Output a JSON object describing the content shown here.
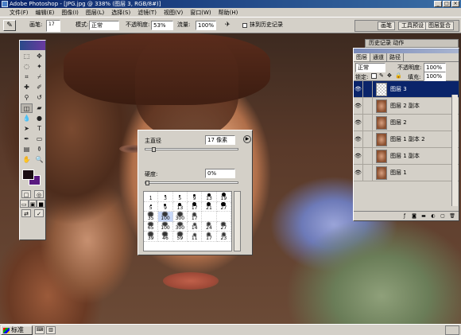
{
  "window": {
    "title": "Adobe Photoshop - [JPG.jpg @ 338% (图层 3, RGB/8#)]",
    "buttons": [
      "_",
      "□",
      "×"
    ]
  },
  "menu": [
    "文件(F)",
    "编辑(E)",
    "图像(I)",
    "图层(L)",
    "选择(S)",
    "滤镜(T)",
    "视图(V)",
    "窗口(W)",
    "帮助(H)"
  ],
  "options": {
    "brush_label": "画笔:",
    "brush_size": "17",
    "mode_label": "模式:",
    "mode_value": "正常",
    "opacity_label": "不透明度:",
    "opacity_value": "53%",
    "flow_label": "流量:",
    "flow_value": "100%",
    "history_checkbox_label": "抹到历史记录",
    "well_tabs": [
      "画笔",
      "工具预设",
      "图层复合"
    ]
  },
  "brush_popup": {
    "master_diameter_label": "主直径",
    "master_diameter_value": "17 像素",
    "master_diameter_fraction": 0.07,
    "hardness_label": "硬度:",
    "hardness_value": "0%",
    "hardness_fraction": 0.0,
    "presets": [
      {
        "size": 1,
        "label": "1"
      },
      {
        "size": 3,
        "label": "3"
      },
      {
        "size": 5,
        "label": "5"
      },
      {
        "size": 9,
        "label": "9"
      },
      {
        "size": 13,
        "label": "13"
      },
      {
        "size": 19,
        "label": "19"
      },
      {
        "size": 5,
        "label": "5"
      },
      {
        "size": 9,
        "label": "9"
      },
      {
        "size": 13,
        "label": "13"
      },
      {
        "size": 17,
        "label": "17"
      },
      {
        "size": 21,
        "label": "21"
      },
      {
        "size": 27,
        "label": "27"
      },
      {
        "size": 35,
        "label": "35"
      },
      {
        "size": 45,
        "label": "45"
      },
      {
        "size": 65,
        "label": "65"
      },
      {
        "size": 100,
        "label": "100"
      },
      {
        "size": 200,
        "label": "200"
      },
      {
        "size": 300,
        "label": "300"
      },
      {
        "size": 9,
        "label": "9"
      },
      {
        "size": 13,
        "label": "13"
      },
      {
        "size": 19,
        "label": "19"
      },
      {
        "size": 17,
        "label": "17"
      },
      {
        "size": 45,
        "label": "45"
      },
      {
        "size": 65,
        "label": "65"
      },
      {
        "size": 100,
        "label": "100"
      },
      {
        "size": 200,
        "label": "200"
      },
      {
        "size": 300,
        "label": "300"
      },
      {
        "size": 14,
        "label": "14"
      },
      {
        "size": 24,
        "label": "24"
      },
      {
        "size": 27,
        "label": "27"
      }
    ],
    "visible_labels": [
      [
        "1",
        "3",
        "5",
        "9",
        "13",
        "19"
      ],
      [
        "5",
        "9",
        "13",
        "17",
        "21",
        "27"
      ],
      [
        "35",
        "100",
        "300",
        "17"
      ],
      [
        "65",
        "100",
        "300",
        "14",
        "24",
        "27"
      ],
      [
        "39",
        "46",
        "59",
        "11",
        "17",
        "23"
      ]
    ]
  },
  "layers_panel": {
    "history_tabs": "历史记录  动作",
    "tabs": [
      "图层",
      "通道",
      "路径"
    ],
    "blend_mode": "正常",
    "opacity_label": "不透明度:",
    "opacity_value": "100%",
    "lock_label": "锁定:",
    "fill_label": "填充:",
    "fill_value": "100%",
    "layers": [
      {
        "name": "图层 3",
        "selected": true,
        "thumb": "empty"
      },
      {
        "name": "图层 2 副本",
        "selected": false,
        "thumb": "photo"
      },
      {
        "name": "图层 2",
        "selected": false,
        "thumb": "photo"
      },
      {
        "name": "图层 1 副本 2",
        "selected": false,
        "thumb": "photo"
      },
      {
        "name": "图层 1 副本",
        "selected": false,
        "thumb": "photo"
      },
      {
        "name": "图层 1",
        "selected": false,
        "thumb": "photo"
      }
    ]
  },
  "statusbar": {
    "start_label": "标准"
  },
  "colors": {
    "foreground": "#1a0d14",
    "background": "#5a1a80",
    "selection": "#0a246a"
  }
}
